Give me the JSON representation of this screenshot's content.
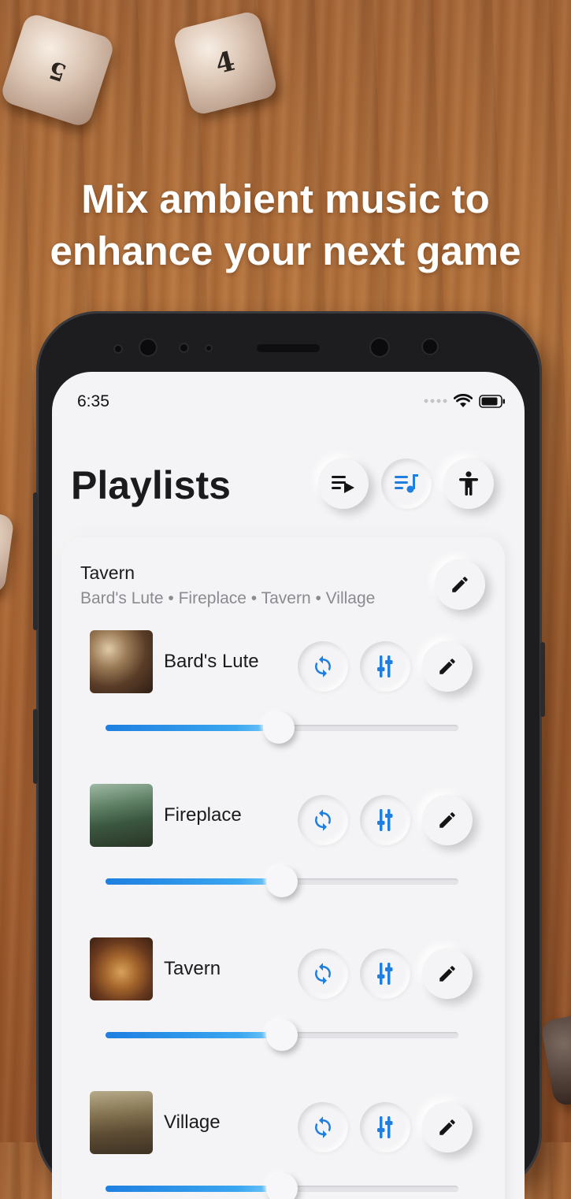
{
  "headline": {
    "line1": "Mix ambient music to",
    "line2": "enhance your next game"
  },
  "dice": [
    {
      "label": "5"
    },
    {
      "label": "4"
    }
  ],
  "status_bar": {
    "time": "6:35"
  },
  "header": {
    "title": "Playlists",
    "buttons": [
      {
        "icon": "queue-play-icon"
      },
      {
        "icon": "music-queue-icon",
        "active": true
      },
      {
        "icon": "accessibility-icon"
      }
    ]
  },
  "playlist": {
    "name": "Tavern",
    "tracks_summary": "Bard's Lute • Fireplace • Tavern • Village",
    "tracks": [
      {
        "name": "Bard's Lute",
        "volume": 0.49
      },
      {
        "name": "Fireplace",
        "volume": 0.5
      },
      {
        "name": "Tavern",
        "volume": 0.5
      },
      {
        "name": "Village",
        "volume": 0.5
      }
    ]
  },
  "colors": {
    "accent": "#1e7fe0",
    "text": "#1b1b1d",
    "secondary_text": "#8a8a90",
    "background": "#f4f4f6"
  }
}
